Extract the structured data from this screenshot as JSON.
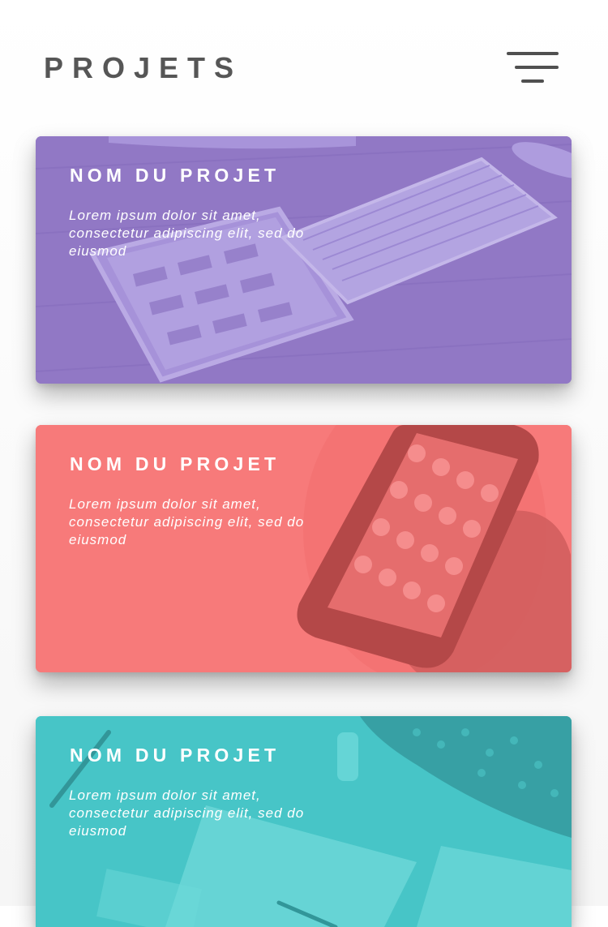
{
  "header": {
    "title": "PROJETS",
    "menu_icon": "hamburger-menu-icon"
  },
  "colors": {
    "title_text": "#565656",
    "card_purple": "#9b83cf",
    "card_coral": "#f97b7b",
    "card_teal": "#4ccccc"
  },
  "projects": [
    {
      "title": "NOM DU PROJET",
      "description": "Lorem ipsum dolor sit amet, consectetur adipiscing elit, sed do eiusmod",
      "image": "laptop-keyboard-tablet-photo"
    },
    {
      "title": "NOM DU PROJET",
      "description": "Lorem ipsum dolor sit amet, consectetur adipiscing elit, sed do eiusmod",
      "image": "smartphone-in-hand-photo"
    },
    {
      "title": "NOM DU PROJET",
      "description": "Lorem ipsum dolor sit amet, consectetur adipiscing elit, sed do eiusmod",
      "image": "desk-with-papers-photo"
    }
  ]
}
